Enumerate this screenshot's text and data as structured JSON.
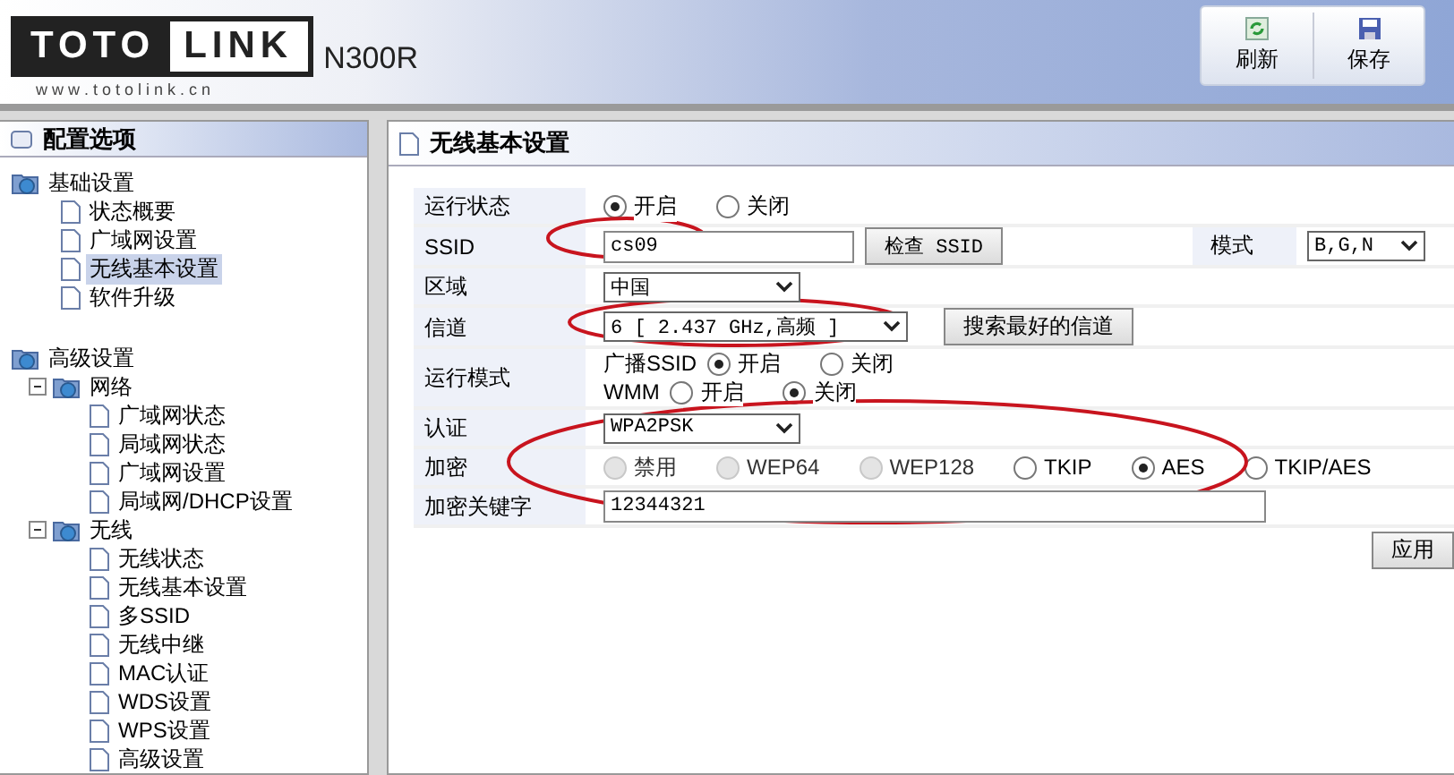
{
  "header": {
    "logo_left": "TOTO",
    "logo_right": "LINK",
    "logo_url": "w w w . t o t o l i n k . c n",
    "model": "N300R",
    "buttons": [
      "刷新",
      "保存"
    ]
  },
  "sidebar": {
    "title": "配置选项",
    "tree": [
      {
        "label": "基础设置",
        "selected": false,
        "children": [
          {
            "label": "状态概要",
            "selected": false
          },
          {
            "label": "广域网设置",
            "selected": false
          },
          {
            "label": "无线基本设置",
            "selected": true
          },
          {
            "label": "软件升级",
            "selected": false
          }
        ]
      },
      {
        "label": "高级设置",
        "selected": false,
        "children": [
          {
            "label": "网络",
            "selected": false,
            "expanded": true,
            "children": [
              {
                "label": "广域网状态",
                "selected": false
              },
              {
                "label": "局域网状态",
                "selected": false
              },
              {
                "label": "广域网设置",
                "selected": false
              },
              {
                "label": "局域网/DHCP设置",
                "selected": false
              }
            ]
          },
          {
            "label": "无线",
            "selected": false,
            "expanded": true,
            "children": [
              {
                "label": "无线状态",
                "selected": false
              },
              {
                "label": "无线基本设置",
                "selected": false
              },
              {
                "label": "多SSID",
                "selected": false
              },
              {
                "label": "无线中继",
                "selected": false
              },
              {
                "label": "MAC认证",
                "selected": false
              },
              {
                "label": "WDS设置",
                "selected": false
              },
              {
                "label": "WPS设置",
                "selected": false
              },
              {
                "label": "高级设置",
                "selected": false
              }
            ]
          }
        ]
      }
    ]
  },
  "main": {
    "title": "无线基本设置",
    "rows": [
      {
        "kind": "radio",
        "label": "运行状态",
        "options": [
          {
            "label": "开启",
            "selected": true
          },
          {
            "label": "关闭",
            "selected": false
          }
        ]
      },
      {
        "kind": "ssid",
        "label": "SSID",
        "value": "cs09",
        "button": "检查 SSID",
        "extra_label": "模式",
        "extra_value": "B,G,N"
      },
      {
        "kind": "select",
        "label": "区域",
        "value": "中国"
      },
      {
        "kind": "select_button",
        "label": "信道",
        "value": "6 [ 2.437 GHz,高频 ]",
        "button": "搜索最好的信道"
      },
      {
        "kind": "groups",
        "label": "运行模式",
        "groups": [
          {
            "label": "广播SSID",
            "options": [
              {
                "label": "开启",
                "selected": true
              },
              {
                "label": "关闭",
                "selected": false
              }
            ]
          },
          {
            "label": "WMM",
            "options": [
              {
                "label": "开启",
                "selected": false
              },
              {
                "label": "关闭",
                "selected": true
              }
            ]
          }
        ]
      },
      {
        "kind": "select",
        "label": "认证",
        "value": "WPA2PSK"
      },
      {
        "kind": "radio",
        "label": "加密",
        "options": [
          {
            "label": "禁用",
            "selected": false,
            "disabled": true
          },
          {
            "label": "WEP64",
            "selected": false,
            "disabled": true
          },
          {
            "label": "WEP128",
            "selected": false,
            "disabled": true
          },
          {
            "label": "TKIP",
            "selected": false,
            "disabled": false
          },
          {
            "label": "AES",
            "selected": true,
            "disabled": false
          },
          {
            "label": "TKIP/AES",
            "selected": false,
            "disabled": false
          }
        ]
      },
      {
        "kind": "text",
        "label": "加密关键字",
        "value": "12344321"
      }
    ],
    "apply_button": "应用"
  }
}
